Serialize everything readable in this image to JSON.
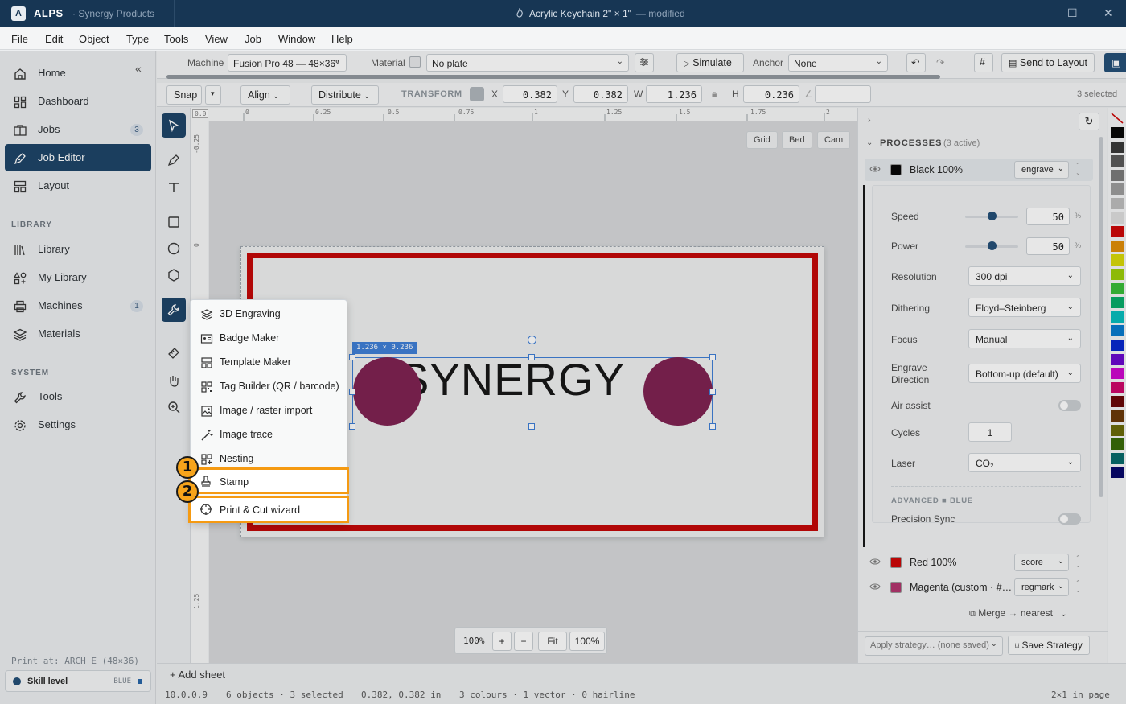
{
  "titlebar": {
    "logo": "A",
    "brand": "ALPS",
    "org": "· Synergy Products",
    "doc_title": "Acrylic Keychain 2\" × 1\"",
    "doc_status": "— modified"
  },
  "menubar": [
    "File",
    "Edit",
    "Object",
    "Type",
    "Tools",
    "View",
    "Job",
    "Window",
    "Help"
  ],
  "sidebar": {
    "items": [
      {
        "label": "Home",
        "icon": "home-icon"
      },
      {
        "label": "Dashboard",
        "icon": "dashboard-icon"
      },
      {
        "label": "Jobs",
        "icon": "jobs-icon",
        "count": "3"
      },
      {
        "label": "Job Editor",
        "icon": "pen-icon",
        "active": true
      },
      {
        "label": "Layout",
        "icon": "layout-icon"
      }
    ],
    "library_heading": "LIBRARY",
    "library": [
      {
        "label": "Library",
        "icon": "books-icon"
      },
      {
        "label": "My Library",
        "icon": "shapes-icon"
      },
      {
        "label": "Machines",
        "icon": "printer-icon",
        "count": "1"
      },
      {
        "label": "Materials",
        "icon": "layers-icon"
      }
    ],
    "system_heading": "SYSTEM",
    "system": [
      {
        "label": "Tools",
        "icon": "wrench-icon"
      },
      {
        "label": "Settings",
        "icon": "gear-icon"
      }
    ],
    "print_at": "Print at: ARCH E (48×36)",
    "skill_label": "Skill level",
    "skill_value": "BLUE"
  },
  "machinebar": {
    "machine_label": "Machine",
    "machine_value": "Fusion Pro 48 — 48×36\"",
    "material_label": "Material",
    "material_value": "No plate",
    "simulate": "Simulate",
    "anchor_label": "Anchor",
    "anchor_value": "None",
    "send_to_layout": "Send to Layout"
  },
  "transformbar": {
    "snap": "Snap",
    "align": "Align",
    "distribute": "Distribute",
    "transform": "TRANSFORM",
    "x_label": "X",
    "x": "0.382",
    "y_label": "Y",
    "y": "0.382",
    "w_label": "W",
    "w": "1.236",
    "h_label": "H",
    "h": "0.236",
    "angle_label": "∠",
    "selected": "3 selected"
  },
  "ruler": {
    "top": [
      "0.0",
      "0",
      "0.25",
      "0.5",
      "0.75",
      "1",
      "1.25",
      "1.5",
      "1.75",
      "2"
    ],
    "left": [
      "-0.25",
      "0",
      "1.25"
    ]
  },
  "canvas": {
    "view_buttons": [
      "Grid",
      "Bed",
      "Cam"
    ],
    "text": "SYNERGY",
    "selection_size": "1.236 × 0.236",
    "zoom_value": "100%",
    "zoom_in": "+",
    "zoom_out": "−",
    "fit": "Fit",
    "zoom_100": "100%"
  },
  "popup_menu": [
    {
      "label": "3D Engraving",
      "icon": "layers-icon"
    },
    {
      "label": "Badge Maker",
      "icon": "badge-icon"
    },
    {
      "label": "Template Maker",
      "icon": "template-icon"
    },
    {
      "label": "Tag Builder (QR / barcode)",
      "icon": "qr-icon"
    },
    {
      "label": "Image / raster import",
      "icon": "image-icon"
    },
    {
      "label": "Image trace",
      "icon": "wand-icon"
    },
    {
      "label": "Nesting",
      "icon": "nesting-icon"
    },
    {
      "label": "Stamp",
      "icon": "stamp-icon"
    },
    {
      "label": "Print & Cut wizard",
      "icon": "crosshair-icon"
    }
  ],
  "callouts": [
    "1",
    "2"
  ],
  "processes": {
    "heading": "PROCESSES",
    "active_count": "(3 active)",
    "items": [
      {
        "name": "Black 100%",
        "color": "#000000",
        "mode": "engrave"
      },
      {
        "name": "Red 100%",
        "color": "#cc0000",
        "mode": "score"
      },
      {
        "name": "Magenta (custom · #…",
        "color": "#b0306a",
        "mode": "regmark"
      }
    ],
    "settings": {
      "speed_label": "Speed",
      "speed": "50",
      "power_label": "Power",
      "power": "50",
      "unit": "%",
      "speed_level": 0.5,
      "power_level": 0.5,
      "resolution_label": "Resolution",
      "resolution": "300 dpi",
      "dithering_label": "Dithering",
      "dithering": "Floyd–Steinberg",
      "focus_label": "Focus",
      "focus": "Manual",
      "engrave_dir_label_1": "Engrave",
      "engrave_dir_label_2": "Direction",
      "engrave_dir": "Bottom-up (default)",
      "air_assist_label": "Air assist",
      "cycles_label": "Cycles",
      "cycles": "1",
      "laser_label": "Laser",
      "laser": "CO₂",
      "advanced_label": "ADVANCED ■ BLUE",
      "precision_sync_label": "Precision Sync"
    },
    "merge": "Merge → nearest",
    "apply_strategy": "Apply strategy… (none saved)",
    "save_strategy": "Save Strategy"
  },
  "palette": [
    "#000000",
    "#333333",
    "#555555",
    "#777777",
    "#999999",
    "#bbbbbb",
    "#dddddd",
    "#cc0000",
    "#e08a00",
    "#d8d800",
    "#99cc00",
    "#33bb33",
    "#00aa66",
    "#00bbbb",
    "#0077cc",
    "#0022cc",
    "#6600cc",
    "#cc00cc",
    "#cc0066",
    "#660000",
    "#663300",
    "#666600",
    "#336600",
    "#006666",
    "#000066"
  ],
  "sheetbar": {
    "add_sheet": "+ Add sheet"
  },
  "statusbar": {
    "version": "10.0.0.9",
    "objects": "6 objects · 3 selected",
    "coords": "0.382, 0.382 in",
    "colours": "3 colours · 1 vector · 0 hairline",
    "pages": "2×1 in page"
  }
}
